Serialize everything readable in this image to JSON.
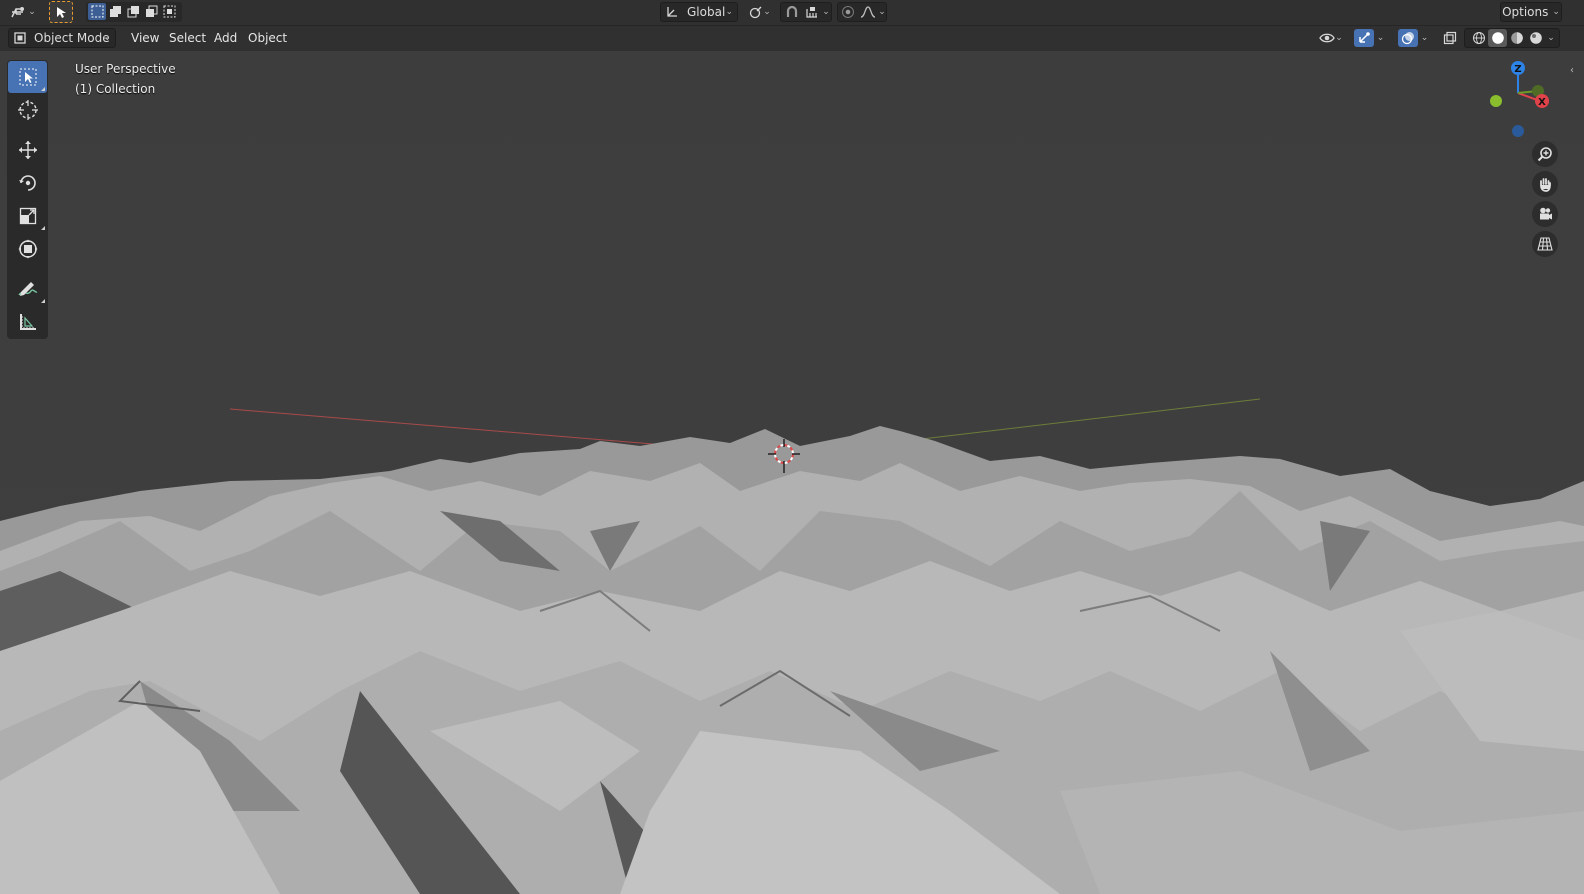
{
  "header": {
    "transform_orientation": "Global",
    "options_label": "Options",
    "mode_label": "Object Mode",
    "menus": [
      "View",
      "Select",
      "Add",
      "Object"
    ]
  },
  "viewport": {
    "perspective_label": "User Perspective",
    "collection_label": "(1) Collection"
  },
  "gizmo": {
    "z_label": "Z",
    "x_label": "X"
  },
  "toolbar": {
    "tools": [
      "select-box",
      "cursor",
      "move",
      "rotate",
      "scale",
      "transform",
      "annotate",
      "measure"
    ],
    "active_tool": "select-box"
  },
  "navigation": {
    "buttons": [
      "zoom",
      "pan",
      "camera-view",
      "toggle-perspective"
    ]
  },
  "colors": {
    "accent": "#4772b3",
    "axis_x": "#e0424a",
    "axis_y": "#8bbe2d",
    "axis_z": "#2d84e6",
    "header_bg": "#303030",
    "viewport_bg": "#3d3d3d"
  }
}
